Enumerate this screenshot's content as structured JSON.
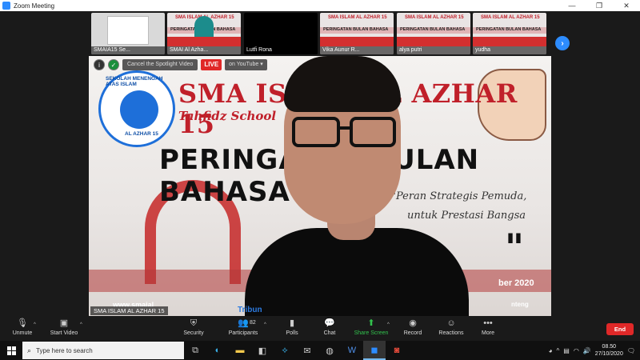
{
  "window": {
    "title": "Zoom Meeting",
    "minimize": "—",
    "maximize": "❐",
    "close": "✕"
  },
  "thumbnails": [
    {
      "name": "SMAIA15 Se...",
      "kind": "doc",
      "doc_text": "VISI"
    },
    {
      "name": "SMAI Al Azha...",
      "kind": "banner",
      "banner_title": "SMA ISLAM AL AZHAR 15",
      "banner_sub": "PERINGATAN BULAN BAHASA"
    },
    {
      "name": "Lutfi Rona",
      "kind": "black"
    },
    {
      "name": "Vika Aunur R...",
      "kind": "banner",
      "banner_title": "SMA ISLAM AL AZHAR 15",
      "banner_sub": "PERINGATAN BULAN BAHASA"
    },
    {
      "name": "alya putri",
      "kind": "banner",
      "banner_title": "SMA ISLAM AL AZHAR 15",
      "banner_sub": "PERINGATAN BULAN BAHASA"
    },
    {
      "name": "yudha",
      "kind": "banner",
      "banner_title": "SMA ISLAM AL AZHAR 15",
      "banner_sub": "PERINGATAN BULAN BAHASA"
    }
  ],
  "next_icon": "›",
  "stage": {
    "info_icon": "i",
    "shield_icon": "✓",
    "cancel_spotlight": "Cancel the Spotlight Video",
    "live": "LIVE",
    "on_youtube": "on YouTube ▾",
    "slide_title": "SMA ISLAM AL AZHAR 15",
    "slide_sub": "Tahfidz School",
    "slide_peringatan": "PERINGATAN BULAN BAHASA",
    "quote_line1": "\"Peran Strategis Pemuda,",
    "quote_line2": "untuk Prestasi Bangsa",
    "quote_mark": "\"",
    "date_fragment": "ber 2020",
    "location_fragment": "nteng",
    "url_fragment": "www.smaial",
    "logo_arc": "SEKOLAH MENENGAH ATAS ISLAM",
    "logo_lower": "AL AZHAR 15",
    "collar_text": "Tribun",
    "speaker_name": "SMA ISLAM AL AZHAR 15"
  },
  "toolbar": {
    "unmute": "Unmute",
    "start_video": "Start Video",
    "security": "Security",
    "participants": "Participants",
    "participants_count": "82",
    "polls": "Polls",
    "chat": "Chat",
    "share_screen": "Share Screen",
    "record": "Record",
    "reactions": "Reactions",
    "more": "More",
    "end": "End",
    "caret": "^"
  },
  "taskbar": {
    "search_placeholder": "Type here to search",
    "time": "08.50",
    "date": "27/10/2020"
  },
  "colors": {
    "zoom_blue": "#2d8cff",
    "end_red": "#e02828",
    "share_green": "#32c24d",
    "brand_red": "#c0202a"
  }
}
